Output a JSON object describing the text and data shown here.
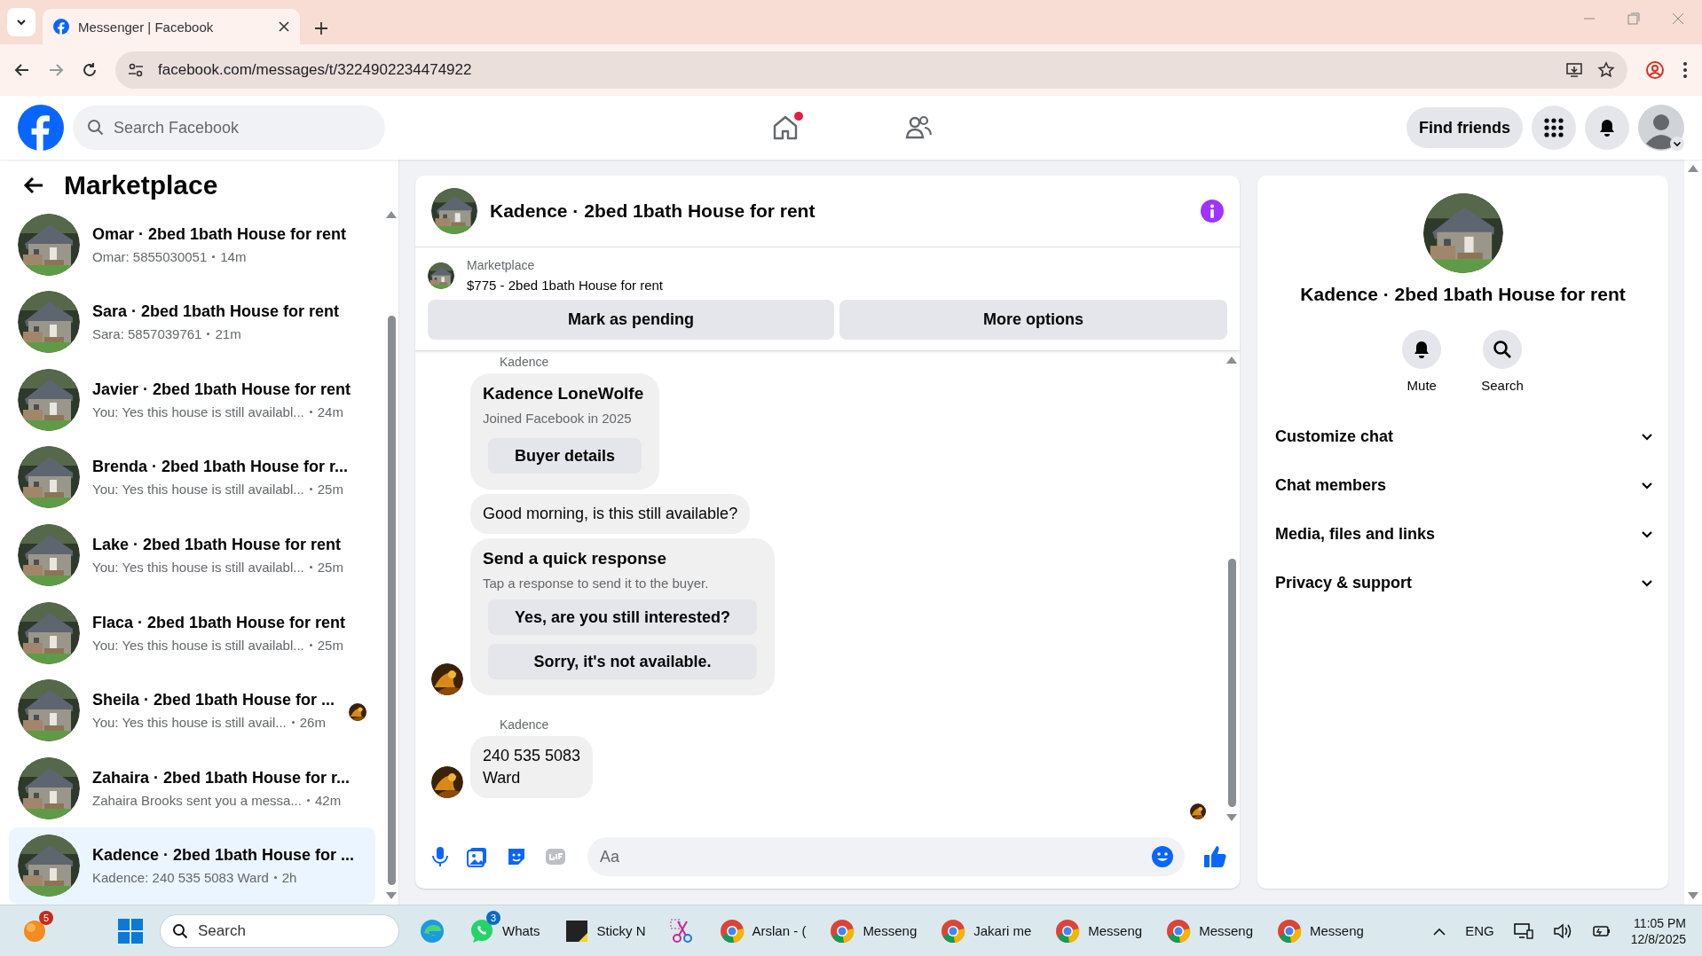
{
  "browser": {
    "tabs": [
      {
        "title": "Messenger | Facebook",
        "selected": true
      }
    ],
    "address": "facebook.com/messages/t/3224902234474922"
  },
  "header": {
    "search": {
      "placeholder": "Search Facebook"
    },
    "nav": [
      {
        "kind": "home",
        "dot": true
      },
      {
        "kind": "friends",
        "dot": false
      }
    ],
    "find_friends": "Find friends"
  },
  "sidebar": {
    "title": "Marketplace",
    "conversations": [
      {
        "title": "Omar · 2bed 1bath House for rent",
        "preview": "Omar: 5855030051",
        "time": "14m",
        "selected": false,
        "seen": false
      },
      {
        "title": "Sara · 2bed 1bath House for rent",
        "preview": "Sara: 5857039761",
        "time": "21m",
        "selected": false,
        "seen": false
      },
      {
        "title": "Javier · 2bed 1bath House for rent",
        "preview": "You: Yes this house is still availabl...",
        "time": "24m",
        "selected": false,
        "seen": false
      },
      {
        "title": "Brenda · 2bed 1bath House for r...",
        "preview": "You: Yes this house is still availabl...",
        "time": "25m",
        "selected": false,
        "seen": false
      },
      {
        "title": "Lake · 2bed 1bath House for rent",
        "preview": "You: Yes this house is still availabl...",
        "time": "25m",
        "selected": false,
        "seen": false
      },
      {
        "title": "Flaca · 2bed 1bath House for rent",
        "preview": "You: Yes this house is still availabl...",
        "time": "25m",
        "selected": false,
        "seen": false
      },
      {
        "title": "Sheila · 2bed 1bath House for ...",
        "preview": "You: Yes this house is still avail...",
        "time": "26m",
        "selected": false,
        "seen": true
      },
      {
        "title": "Zahaira · 2bed 1bath House for r...",
        "preview": "Zahaira Brooks sent you a messa...",
        "time": "42m",
        "selected": false,
        "seen": false
      },
      {
        "title": "Kadence · 2bed 1bath House for ...",
        "preview": "Kadence: 240 535 5083 Ward",
        "time": "2h",
        "selected": true,
        "seen": false
      }
    ]
  },
  "chat": {
    "title": "Kadence · 2bed 1bath House for rent",
    "listing": {
      "label": "Marketplace",
      "title": "$775 - 2bed 1bath House for rent"
    },
    "actions": [
      "Mark as pending",
      "More options"
    ],
    "messages": [
      {
        "kind": "sender",
        "text": "Kadence"
      },
      {
        "kind": "profile",
        "name": "Kadence LoneWolfe",
        "subtitle": "Joined Facebook in 2025",
        "button": "Buyer details",
        "avatar": false
      },
      {
        "kind": "text",
        "lines": [
          "Good morning, is this still available?"
        ],
        "avatar": false
      },
      {
        "kind": "quick",
        "title": "Send a quick response",
        "subtitle": "Tap a response to send it to the buyer.",
        "options": [
          "Yes, are you still interested?",
          "Sorry, it's not available."
        ],
        "avatar": true
      },
      {
        "kind": "sender",
        "text": "Kadence"
      },
      {
        "kind": "text",
        "lines": [
          "240 535 5083",
          "Ward"
        ],
        "avatar": true
      }
    ],
    "composer": {
      "placeholder": "Aa"
    }
  },
  "details": {
    "title": "Kadence · 2bed 1bath House for rent",
    "actions": [
      {
        "kind": "bell",
        "label": "Mute"
      },
      {
        "kind": "search",
        "label": "Search"
      }
    ],
    "sections": [
      {
        "label": "Customize chat",
        "expanded": false
      },
      {
        "label": "Chat members",
        "expanded": false
      },
      {
        "label": "Media, files and links",
        "expanded": false
      },
      {
        "label": "Privacy & support",
        "expanded": false
      }
    ]
  },
  "taskbar": {
    "weather_badge": "5",
    "search": {
      "placeholder": "Search"
    },
    "apps": [
      {
        "kind": "edge"
      },
      {
        "kind": "whatsapp",
        "label": "Whats",
        "badge": "3"
      },
      {
        "kind": "sticky",
        "label": "Sticky N"
      },
      {
        "kind": "snip"
      },
      {
        "kind": "chrome",
        "label": "Arslan - ("
      },
      {
        "kind": "chrome",
        "label": "Messeng"
      },
      {
        "kind": "chrome",
        "label": "Jakari me"
      },
      {
        "kind": "chrome",
        "label": "Messeng"
      },
      {
        "kind": "chrome",
        "label": "Messeng"
      },
      {
        "kind": "chrome",
        "label": "Messeng"
      }
    ],
    "language": "ENG",
    "time": "11:05 PM",
    "date": "12/8/2025"
  }
}
